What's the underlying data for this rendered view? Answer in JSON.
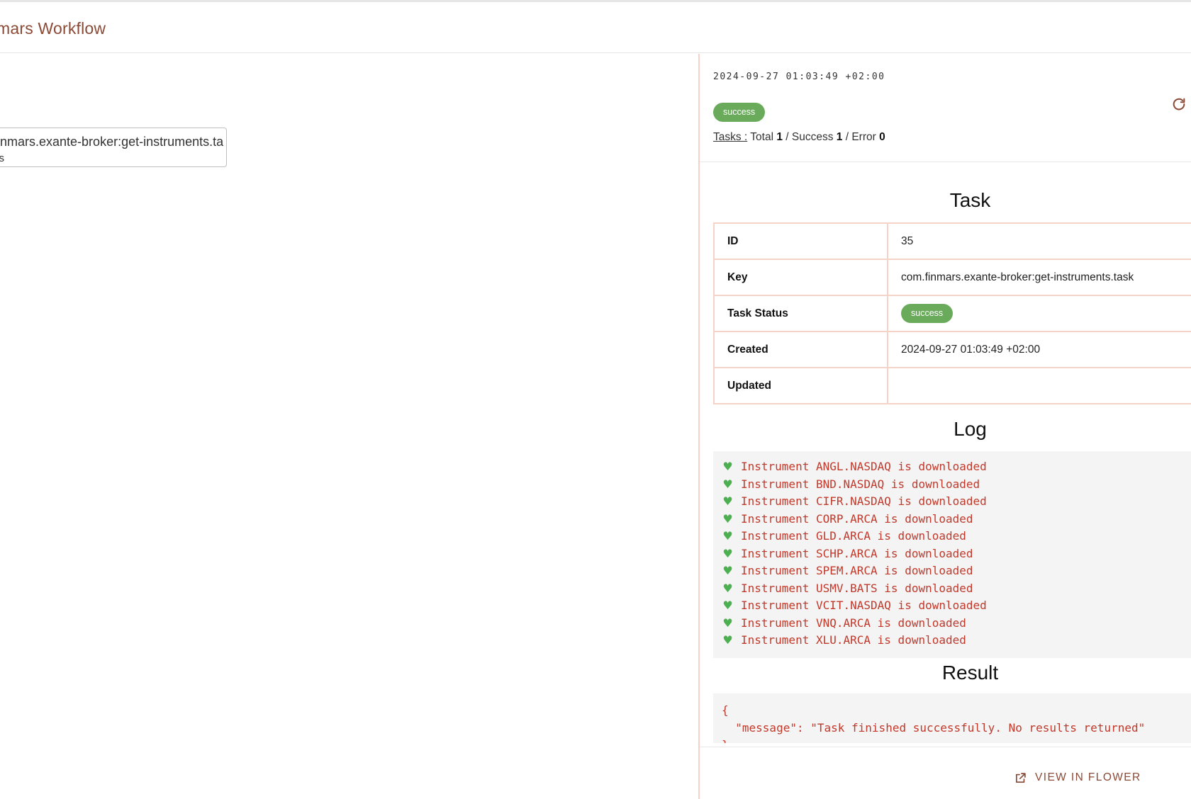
{
  "header": {
    "title": "nmars Workflow"
  },
  "canvas": {
    "node": {
      "title": "finmars.exante-broker:get-instruments.ta",
      "status": "ss"
    }
  },
  "panel": {
    "date": "2024-09-27 01:03:49 +02:00",
    "status": "success",
    "tasks_summary": {
      "link": "Tasks :",
      "total_label": "Total",
      "total": "1",
      "success_label": "/ Success",
      "success": "1",
      "error_label": "/ Error",
      "error": "0"
    },
    "task_section_title": "Task",
    "info_rows": [
      {
        "key": "ID",
        "value": "35"
      },
      {
        "key": "Key",
        "value": "com.finmars.exante-broker:get-instruments.task"
      },
      {
        "key": "Task Status",
        "value": "success"
      },
      {
        "key": "Created",
        "value": "2024-09-27 01:03:49 +02:00"
      },
      {
        "key": "Updated",
        "value": ""
      }
    ],
    "log_section_title": "Log",
    "log_lines": [
      "Instrument ANGL.NASDAQ is downloaded",
      "Instrument BND.NASDAQ is downloaded",
      "Instrument CIFR.NASDAQ is downloaded",
      "Instrument CORP.ARCA is downloaded",
      "Instrument GLD.ARCA is downloaded",
      "Instrument SCHP.ARCA is downloaded",
      "Instrument SPEM.ARCA is downloaded",
      "Instrument USMV.BATS is downloaded",
      "Instrument VCIT.NASDAQ is downloaded",
      "Instrument VNQ.ARCA is downloaded",
      "Instrument XLU.ARCA is downloaded"
    ],
    "log_icon": "green-heart-icon",
    "result_section_title": "Result",
    "result_text": "{\n  \"message\": \"Task finished successfully. No results returned\"\n}",
    "footer": {
      "view_in_flower": "VIEW IN FLOWER"
    }
  },
  "colors": {
    "accent": "#8b4a36",
    "success": "#6aab5b",
    "border": "#f6d3c7",
    "code": "#c0392b"
  }
}
